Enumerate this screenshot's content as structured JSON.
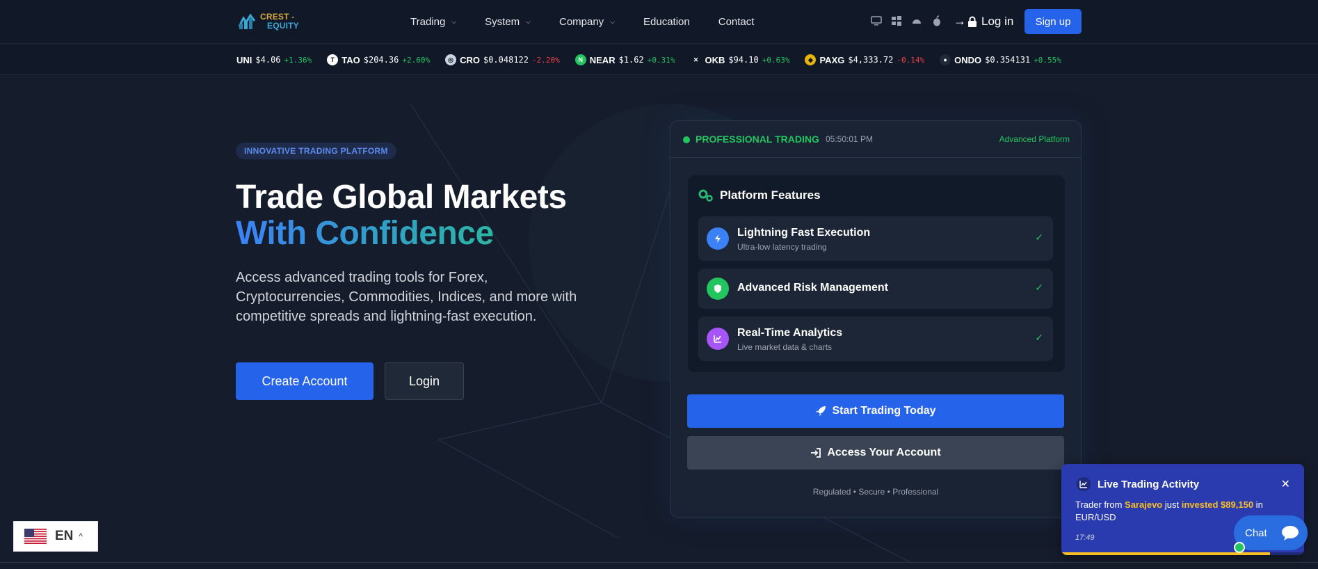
{
  "brand": {
    "line1": "CREST -",
    "line2": "EQUITY"
  },
  "nav": [
    {
      "label": "Trading",
      "dropdown": true
    },
    {
      "label": "System",
      "dropdown": true
    },
    {
      "label": "Company",
      "dropdown": true
    },
    {
      "label": "Education",
      "dropdown": false
    },
    {
      "label": "Contact",
      "dropdown": false
    }
  ],
  "header": {
    "login": "Log in",
    "signup": "Sign up"
  },
  "platform_icons": [
    "desktop-icon",
    "windows-icon",
    "android-icon",
    "apple-icon"
  ],
  "ticker": [
    {
      "symbol": "UNI",
      "price": "$4.06",
      "change": "+1.36%",
      "dir": "up",
      "icon": "",
      "color": "transparent"
    },
    {
      "symbol": "TAO",
      "price": "$204.36",
      "change": "+2.60%",
      "dir": "up",
      "icon": "T",
      "color": "#ffffff"
    },
    {
      "symbol": "CRO",
      "price": "$0.048122",
      "change": "-2.20%",
      "dir": "down",
      "icon": "◎",
      "color": "#cbd5e1"
    },
    {
      "symbol": "NEAR",
      "price": "$1.62",
      "change": "+0.31%",
      "dir": "up",
      "icon": "N",
      "color": "#22c55e"
    },
    {
      "symbol": "OKB",
      "price": "$94.10",
      "change": "+0.63%",
      "dir": "up",
      "icon": "✕",
      "color": "#111827"
    },
    {
      "symbol": "PAXG",
      "price": "$4,333.72",
      "change": "-0.14%",
      "dir": "down",
      "icon": "◆",
      "color": "#eab308"
    },
    {
      "symbol": "ONDO",
      "price": "$0.354131",
      "change": "+0.55%",
      "dir": "up",
      "icon": "●",
      "color": "#1f2937"
    }
  ],
  "hero": {
    "badge": "INNOVATIVE TRADING PLATFORM",
    "title_line1": "Trade Global Markets",
    "title_line2": "With Confidence",
    "lead": "Access advanced trading tools for Forex, Cryptocurrencies, Commodities, Indices, and more with competitive spreads and lightning-fast execution.",
    "btn_create": "Create Account",
    "btn_login": "Login"
  },
  "card": {
    "status": "PROFESSIONAL TRADING",
    "clock": "05:50:01 PM",
    "tag": "Advanced Platform",
    "features_title": "Platform Features",
    "features": [
      {
        "name": "Lightning Fast Execution",
        "sub": "Ultra-low latency trading",
        "icon": "bolt-icon",
        "color": "#3b82f6"
      },
      {
        "name": "Advanced Risk Management",
        "sub": "",
        "icon": "shield-icon",
        "color": "#22c55e"
      },
      {
        "name": "Real-Time Analytics",
        "sub": "Live market data & charts",
        "icon": "chart-icon",
        "color": "#a855f7"
      }
    ],
    "btn_start": "Start Trading Today",
    "btn_access": "Access Your Account",
    "footnote": "Regulated • Secure • Professional"
  },
  "language": {
    "code": "EN"
  },
  "activity": {
    "title": "Live Trading Activity",
    "text_prefix": "Trader from ",
    "city": "Sarajevo",
    "text_mid": " just ",
    "amount": "invested $89,150",
    "text_suffix": " in EUR/USD",
    "time": "17:49",
    "progress": 0.86
  },
  "chat": {
    "label": "Chat"
  },
  "colors": {
    "accent": "#2563eb",
    "success": "#22c55e",
    "danger": "#ef4444",
    "highlight": "#fbbf24"
  }
}
